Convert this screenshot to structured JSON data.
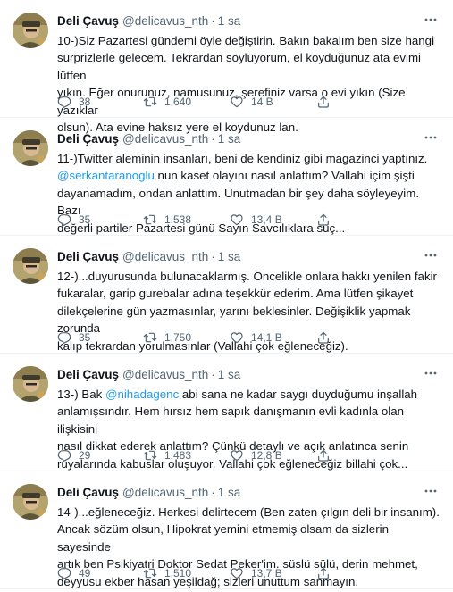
{
  "author": {
    "name": "Deli Çavuş",
    "handle": "@delicavus_nth",
    "time": "1 sa",
    "separator": "·"
  },
  "tweets": [
    {
      "lines": [
        [
          {
            "t": "10-)Siz Pazartesi gündemi öyle değiştirin. Bakın bakalım ben size hangi"
          }
        ],
        [
          {
            "t": "sürprizlerle gelecem. Tekrardan söylüyorum, el koyduğunuz ata evimi lütfen"
          }
        ],
        [
          {
            "t": "yıkın. Eğer onurunuz, namusunuz, şerefiniz varsa o evi yıkın (Size yazıklar"
          }
        ],
        [
          {
            "t": "olsun). Ata evine haksız yere el koydunuz lan."
          }
        ]
      ],
      "replies": "38",
      "retweets": "1.640",
      "likes": "14 B"
    },
    {
      "lines": [
        [
          {
            "t": "11-)Twitter aleminin insanları, beni de kendiniz gibi magazinci yaptınız."
          }
        ],
        [
          {
            "t": "@serkantaranoglu",
            "m": true
          },
          {
            "t": " nun kaset olayını nasıl anlattım? Vallahi içim şişti"
          }
        ],
        [
          {
            "t": "dayanamadım, ondan anlattım. Unutmadan bir şey daha söyleyeyim. Bazı"
          }
        ],
        [
          {
            "t": "değerli partiler Pazartesi günü Sayın Savcılıklara suç..."
          }
        ]
      ],
      "replies": "35",
      "retweets": "1.538",
      "likes": "13,4 B"
    },
    {
      "lines": [
        [
          {
            "t": "12-)...duyurusunda bulunacaklarmış. Öncelikle onlara hakkı yenilen fakir"
          }
        ],
        [
          {
            "t": "fukaralar, garip gurebalar adına teşekkür ederim. Ama lütfen şikayet"
          }
        ],
        [
          {
            "t": "dilekçelerine gün yazmasınlar, yarını beklesinler. Değişiklik yapmak zorunda"
          }
        ],
        [
          {
            "t": "kalıp tekrardan yorulmasınlar (Vallahi çok eğleneceğiz)."
          }
        ]
      ],
      "replies": "35",
      "retweets": "1.750",
      "likes": "14,1 B"
    },
    {
      "lines": [
        [
          {
            "t": "13-) Bak "
          },
          {
            "t": "@nihadagenc",
            "m": true
          },
          {
            "t": " abi sana ne kadar saygı duyduğumu inşallah"
          }
        ],
        [
          {
            "t": "anlamışsındır. Hem hırsız hem sapık danışmanın evli kadınla olan ilişkisini"
          }
        ],
        [
          {
            "t": "nasıl dikkat ederek anlattım? Çünkü detaylı ve açık anlatınca senin"
          }
        ],
        [
          {
            "t": "rüyalarında kabuslar oluşuyor. Vallahi çok eğleneceğiz billahi çok..."
          }
        ]
      ],
      "replies": "29",
      "retweets": "1.483",
      "likes": "12,8 B"
    },
    {
      "lines": [
        [
          {
            "t": "14-)...eğleneceğiz. Herkesi delirtecem (Ben zaten çılgın deli bir insanım)."
          }
        ],
        [
          {
            "t": "Ancak sözüm olsun, Hipokrat yemini etmemiş olsam da sizlerin sayesinde"
          }
        ],
        [
          {
            "t": "artık ben Psikiyatri Doktor Sedat Peker'im. süslü sülü, derin mehmet,"
          }
        ],
        [
          {
            "t": "deyyusu ekber hasan yeşildağ; sizleri unuttum sanmayın."
          }
        ]
      ],
      "replies": "49",
      "retweets": "1.510",
      "likes": "13,7 B"
    }
  ],
  "colors": {
    "text": "#0f1419",
    "secondary": "#536471",
    "mention": "#1d9bf0",
    "divider": "#eff3f4"
  },
  "icons": {
    "reply": "reply-icon",
    "retweet": "retweet-icon",
    "like": "heart-icon",
    "share": "share-icon",
    "more": "more-icon"
  }
}
